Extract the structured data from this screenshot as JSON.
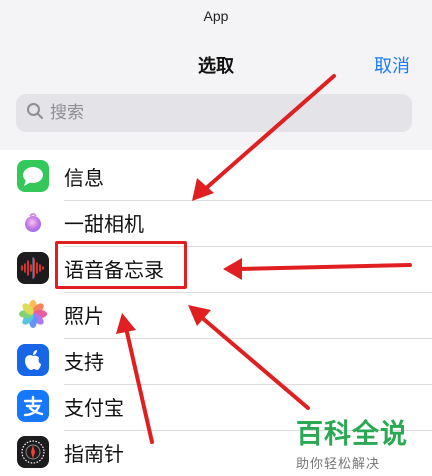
{
  "sheet": {
    "top_label": "App",
    "title": "选取",
    "cancel_label": "取消"
  },
  "search": {
    "placeholder": "搜索",
    "value": ""
  },
  "apps": [
    {
      "label": "信息",
      "icon": "messages-icon"
    },
    {
      "label": "一甜相机",
      "icon": "camera-app-icon"
    },
    {
      "label": "语音备忘录",
      "icon": "voice-memos-icon"
    },
    {
      "label": "照片",
      "icon": "photos-icon"
    },
    {
      "label": "支持",
      "icon": "apple-support-icon"
    },
    {
      "label": "支付宝",
      "icon": "alipay-icon"
    },
    {
      "label": "指南针",
      "icon": "compass-icon"
    }
  ],
  "annotation": {
    "highlight_color": "#e02020",
    "highlighted_item": "语音备忘录"
  },
  "watermark": {
    "main": "百科全说",
    "sub": "助你轻松解决"
  },
  "colors": {
    "accent": "#1a7cf5",
    "messages": "#34c759",
    "support": "#1766e8",
    "alipay": "#1677ff",
    "watermark": "#2aa852"
  }
}
